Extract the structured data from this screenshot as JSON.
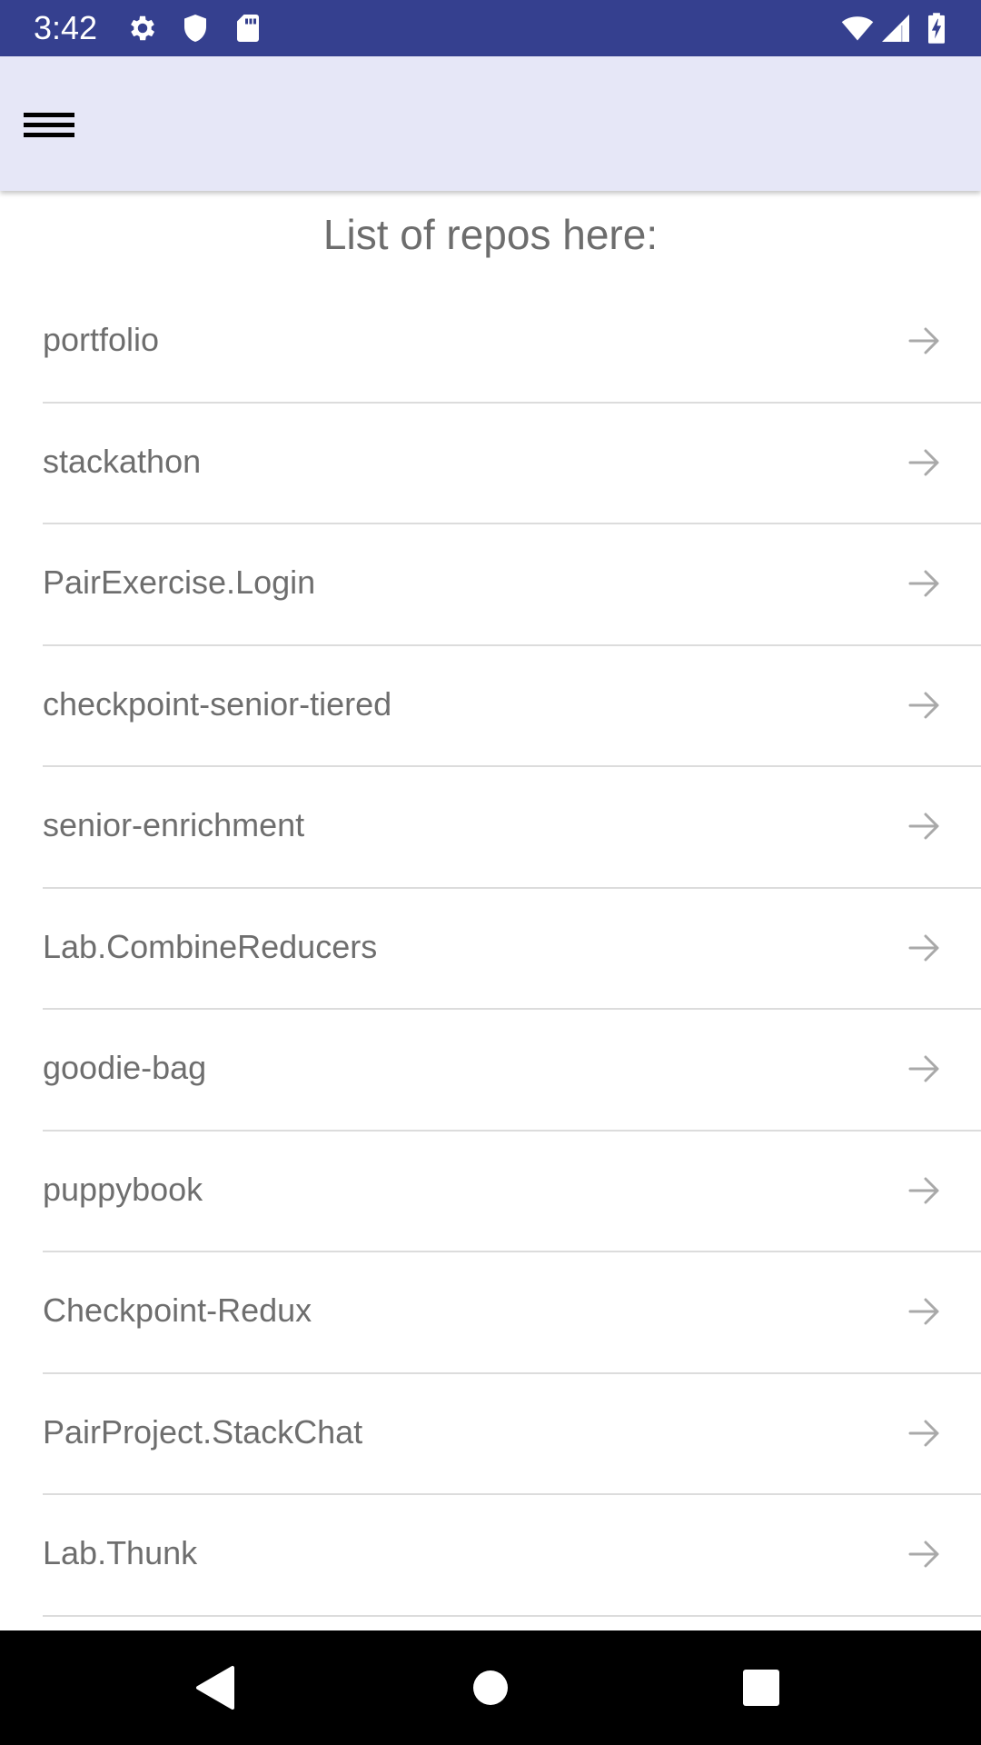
{
  "status_bar": {
    "time": "3:42",
    "left_icons": [
      "gear-icon",
      "shield-icon",
      "sd-card-icon"
    ],
    "right_icons": [
      "wifi-icon",
      "cell-signal-icon",
      "battery-charging-icon"
    ],
    "background": "#35408f"
  },
  "app_bar": {
    "menu_icon": "hamburger-menu-icon",
    "background": "#e6e7f7"
  },
  "main": {
    "title": "List of repos here:",
    "repos": [
      {
        "label": "portfolio"
      },
      {
        "label": "stackathon"
      },
      {
        "label": "PairExercise.Login"
      },
      {
        "label": "checkpoint-senior-tiered"
      },
      {
        "label": "senior-enrichment"
      },
      {
        "label": "Lab.CombineReducers"
      },
      {
        "label": "goodie-bag"
      },
      {
        "label": "puppybook"
      },
      {
        "label": "Checkpoint-Redux"
      },
      {
        "label": "PairProject.StackChat"
      },
      {
        "label": "Lab.Thunk"
      }
    ],
    "row_icon": "arrow-right-icon"
  },
  "nav_bar": {
    "buttons": [
      "back-triangle-icon",
      "home-circle-icon",
      "recents-square-icon"
    ]
  }
}
